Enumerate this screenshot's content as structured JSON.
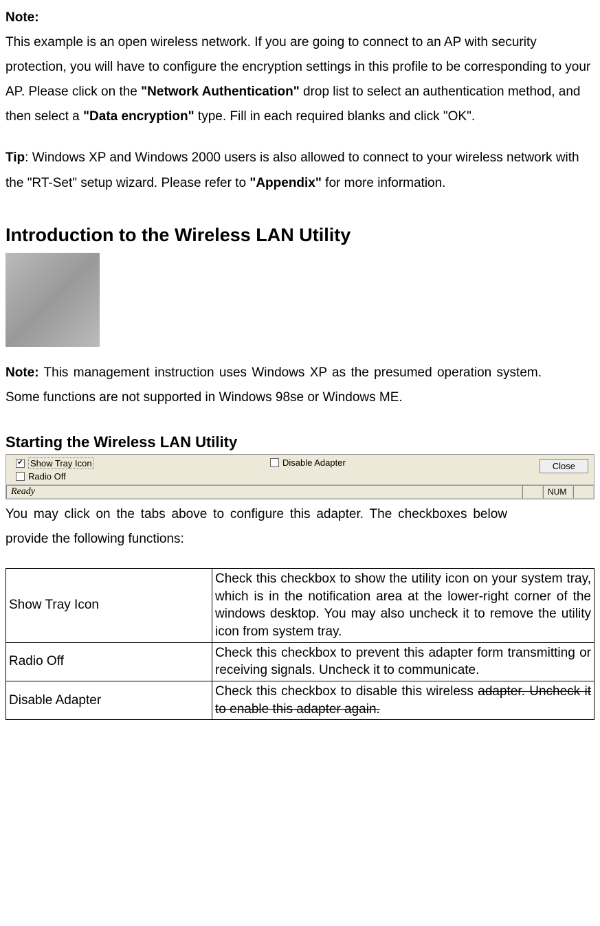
{
  "note": {
    "label": "Note:",
    "p1_a": "This example is an open wireless network. If you are going to connect to an AP with security protection, you will have to configure the encryption settings in this profile to be corresponding to your AP. Please click on the ",
    "p1_b": "\"Network Authentication\"",
    "p1_c": " drop list to select an authentication method, and then select a ",
    "p1_d": "\"Data encryption\"",
    "p1_e": " type. Fill in each required blanks and click \"OK\"."
  },
  "tip": {
    "label": "Tip",
    "a": ": Windows XP and Windows 2000 users is also allowed to connect to your wireless network with the \"RT-Set\" setup wizard. Please refer to ",
    "b": "\"Appendix\"",
    "c": " for more information."
  },
  "intro_heading": "Introduction to the Wireless LAN Utility",
  "note2": {
    "label": "Note:",
    "text": " This management instruction uses Windows XP as the presumed operation system. Some functions are not supported in Windows 98se or Windows ME."
  },
  "starting_heading": "Starting the Wireless LAN Utility",
  "toolbar": {
    "show_tray": "Show Tray Icon",
    "radio_off": "Radio Off",
    "disable_adapter": "Disable Adapter",
    "close": "Close",
    "ready": "Ready",
    "num": "NUM"
  },
  "after_shot": "You may click on the tabs above to configure this adapter. The checkboxes  below provide the following functions:",
  "table": {
    "rows": [
      {
        "left": "Show Tray Icon",
        "right": "Check this checkbox to show the utility icon on your system tray, which is in the notification area at the lower-right corner of the windows desktop. You may also uncheck it to remove the utility icon from system tray."
      },
      {
        "left": "Radio Off",
        "right": "Check this checkbox to prevent this adapter form transmitting or receiving signals. Uncheck it to communicate."
      },
      {
        "left": "Disable Adapter",
        "right_a": "Check this checkbox to disable this wireless ",
        "right_b": "adapter. Uncheck it to enable this adapter again."
      }
    ]
  }
}
